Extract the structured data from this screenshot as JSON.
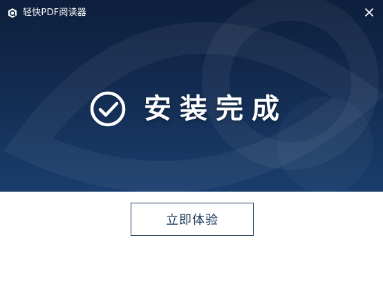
{
  "window": {
    "app_name": "轻快PDF阅读器",
    "logo_icon": "pdf-reader-logo-icon",
    "close_icon": "close-icon"
  },
  "main": {
    "status_icon": "check-circle-icon",
    "status_text": "安装完成",
    "action_label": "立即体验"
  },
  "colors": {
    "banner_top": "#0d1f3c",
    "banner_bottom": "#1a3d6d",
    "button_border": "#1b3a5c",
    "button_text": "#1b3a5c"
  }
}
